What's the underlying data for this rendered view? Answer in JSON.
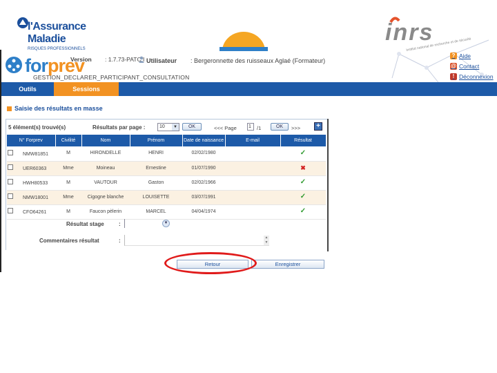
{
  "branding": {
    "assurance_line1": "l'Assurance",
    "assurance_line2": "Maladie",
    "assurance_tagline": "RISQUES PROFESSIONNELS",
    "inrs": "inrs",
    "inrs_tagline": "institut national de recherche et de sécurité",
    "app_logo_for": "for",
    "app_logo_prev": "prev"
  },
  "header": {
    "version_label": "Version",
    "version_value": ": 1.7.73-PATC I",
    "user_label": "Utilisateur",
    "user_value": ": Bergeronnette des ruisseaux Aglaé (Formateur)",
    "screen_code": "GESTION_DECLARER_PARTICIPANT_CONSULTATION",
    "links": [
      {
        "label": "Aide",
        "icon": "help-icon",
        "color": "#f29222"
      },
      {
        "label": "Contact",
        "icon": "mail-icon",
        "color": "#d9532c"
      },
      {
        "label": "Déconnexion",
        "icon": "logout-icon",
        "color": "#c0392b"
      }
    ]
  },
  "menu": {
    "outils": "Outils",
    "sessions": "Sessions"
  },
  "page": {
    "title": "Saisie des résultats en masse"
  },
  "results": {
    "found_text": "5 élément(s) trouvé(s)",
    "per_page_label": "Résultats par page :",
    "per_page_value": "10",
    "ok_label": "OK",
    "pager_prev": "<<< Page",
    "page_value": "1",
    "page_total": "/1",
    "pager_next": ">>>",
    "columns": [
      "N° Forprev",
      "Civilité",
      "Nom",
      "Prénom",
      "Date de naissance",
      "E-mail",
      "Résultat"
    ],
    "rows": [
      {
        "id": "NMW81851",
        "civ": "M",
        "nom": "HIRONDELLE",
        "prenom": "HENRI",
        "dob": "02/02/1980",
        "email": "",
        "result": "ok"
      },
      {
        "id": "UER60363",
        "civ": "Mme",
        "nom": "Moineau",
        "prenom": "Ernestine",
        "dob": "01/07/1990",
        "email": "",
        "result": "ko"
      },
      {
        "id": "HWH80533",
        "civ": "M",
        "nom": "VAUTOUR",
        "prenom": "Gaston",
        "dob": "02/02/1966",
        "email": "",
        "result": "ok"
      },
      {
        "id": "NMW18001",
        "civ": "Mme",
        "nom": "Cigogne blanche",
        "prenom": "LOUISETTE",
        "dob": "03/07/1991",
        "email": "",
        "result": "ok"
      },
      {
        "id": "CFO64261",
        "civ": "M",
        "nom": "Faucon pèlerin",
        "prenom": "MARCEL",
        "dob": "04/04/1974",
        "email": "",
        "result": "ok"
      }
    ],
    "result_symbols": {
      "ok": "✓",
      "ko": "✖"
    },
    "stage_label": "Résultat stage",
    "comment_label": "Commentaires résultat",
    "colon": ":"
  },
  "actions": {
    "retour": "Retour",
    "save": "Enregistrer"
  },
  "colors": {
    "primary_blue": "#1d5aa8",
    "accent_orange": "#f29222",
    "highlight_red": "#e01b1b",
    "row_alt": "#fbf1e2"
  }
}
